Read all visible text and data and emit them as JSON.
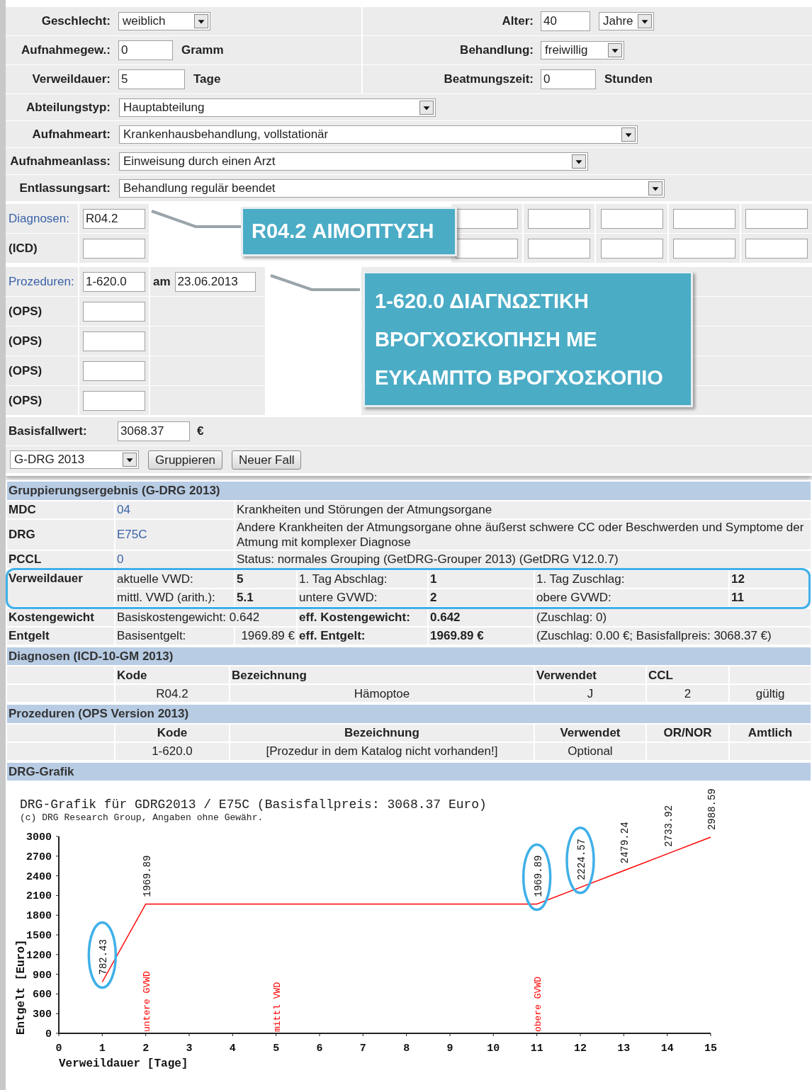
{
  "case_form": {
    "rows": [
      {
        "left": {
          "label": "Geschlecht:",
          "controls": [
            {
              "kind": "select",
              "value": "weiblich"
            }
          ]
        },
        "right": {
          "label": "Alter:",
          "controls": [
            {
              "kind": "input",
              "value": "40"
            },
            {
              "kind": "select",
              "value": "Jahre"
            }
          ]
        }
      },
      {
        "left": {
          "label": "Aufnahmegew.:",
          "controls": [
            {
              "kind": "input",
              "value": "0"
            }
          ],
          "unit": "Gramm"
        },
        "right": {
          "label": "Behandlung:",
          "controls": [
            {
              "kind": "select",
              "value": "freiwillig"
            }
          ]
        }
      },
      {
        "left": {
          "label": "Verweildauer:",
          "controls": [
            {
              "kind": "input",
              "value": "5"
            }
          ],
          "unit": "Tage"
        },
        "right": {
          "label": "Beatmungszeit:",
          "controls": [
            {
              "kind": "input",
              "value": "0"
            }
          ],
          "unit": "Stunden"
        }
      }
    ],
    "wide_rows": [
      {
        "label": "Abteilungstyp:",
        "value": "Hauptabteilung"
      },
      {
        "label": "Aufnahmeart:",
        "value": "Krankenhausbehandlung, vollstationär"
      },
      {
        "label": "Aufnahmeanlass:",
        "value": "Einweisung durch einen Arzt"
      },
      {
        "label": "Entlassungsart:",
        "value": "Behandlung regulär beendet"
      }
    ]
  },
  "diagnoses": {
    "label": "Diagnosen:",
    "sublabel": "(ICD)",
    "code": "R04.2",
    "callout": "R04.2 ΑΙΜΟΠΤΥΣΗ"
  },
  "procedures": {
    "label": "Prozeduren:",
    "code": "1-620.0",
    "date_label": "am",
    "date": "23.06.2013",
    "extra_labels": [
      "(OPS)",
      "(OPS)",
      "(OPS)",
      "(OPS)"
    ],
    "callout_lines": [
      "1-620.0 ΔΙΑΓΝΩΣΤΙΚΗ",
      "ΒΡΟΓΧΟΣΚΟΠΗΣΗ ΜΕ",
      "ΕΥΚΑΜΠΤΟ ΒΡΟΓΧΟΣΚΟΠΙΟ"
    ]
  },
  "base_rate": {
    "label": "Basisfallwert:",
    "value": "3068.37",
    "unit": "€"
  },
  "actions": {
    "catalog": "G-DRG 2013",
    "buttons": [
      "Gruppieren",
      "Neuer Fall"
    ]
  },
  "result": {
    "title": "Gruppierungsergebnis (G-DRG 2013)",
    "rows": [
      {
        "kind": "link",
        "label": "MDC",
        "link": "04",
        "text": "Krankheiten und Störungen der Atmungsorgane"
      },
      {
        "kind": "link",
        "label": "DRG",
        "link": "E75C",
        "text": "Andere Krankheiten der Atmungsorgane ohne äußerst schwere CC oder Beschwerden und Symptome der Atmung mit komplexer Diagnose"
      },
      {
        "kind": "link",
        "label": "PCCL",
        "link": "0",
        "text": "Status: normales Grouping (GetDRG-Grouper 2013) (GetDRG V12.0.7)"
      },
      {
        "kind": "stay",
        "label": "Verweildauer",
        "highlighted": true,
        "lines": [
          [
            "aktuelle VWD:",
            "5",
            "1. Tag Abschlag:",
            "1",
            "1. Tag Zuschlag:",
            "12"
          ],
          [
            "mittl. VWD (arith.):",
            "5.1",
            "untere GVWD:",
            "2",
            "obere GVWD:",
            "11"
          ]
        ]
      },
      {
        "kind": "weight",
        "label": "Kostengewicht",
        "cells": [
          "Basiskostengewicht: 0.642",
          "eff. Kostengewicht:",
          "0.642",
          "(Zuschlag: 0)"
        ]
      },
      {
        "kind": "fee",
        "label": "Entgelt",
        "cells": [
          "Basisentgelt:",
          "1969.89 €",
          "eff. Entgelt:",
          "1969.89 €",
          "(Zuschlag: 0.00 €; Basisfallpreis: 3068.37 €)"
        ]
      }
    ]
  },
  "diagnosis_table": {
    "title": "Diagnosen (ICD-10-GM 2013)",
    "columns": [
      "Kode",
      "Bezeichnung",
      "Verwendet",
      "CCL"
    ],
    "rows": [
      [
        "R04.2",
        "Hämoptoe",
        "J",
        "2",
        "gültig"
      ]
    ]
  },
  "procedure_table": {
    "title": "Prozeduren (OPS Version 2013)",
    "columns": [
      "Kode",
      "Bezeichnung",
      "Verwendet",
      "OR/NOR",
      "Amtlich"
    ],
    "rows": [
      [
        "1-620.0",
        "[Prozedur in dem Katalog nicht vorhanden!]",
        "Optional"
      ]
    ]
  },
  "graphic": {
    "title": "DRG-Grafik",
    "caption": "(c) DRG Research Group, Angaben ohne Gewähr.",
    "circled": [
      true,
      false,
      true,
      true,
      false,
      false,
      false
    ],
    "markers": [
      {
        "day": "2",
        "text": "untere GVWD"
      },
      {
        "day": "5",
        "text": "mittl VWD"
      },
      {
        "day": "11",
        "text": "obere GVWD"
      }
    ],
    "chart_data": {
      "type": "line",
      "title": "DRG-Grafik für GDRG2013 / E75C (Basisfallpreis: 3068.37 Euro)",
      "xlabel": "Verweildauer [Tage]",
      "ylabel": "Entgelt [Euro]",
      "x": [
        1,
        2,
        11,
        12,
        13,
        14,
        15
      ],
      "series": [
        {
          "color": "#ff0000",
          "values": [
            782.43,
            1969.89,
            1969.89,
            2224.57,
            2479.24,
            2733.92,
            2988.59
          ]
        }
      ],
      "xlim": [
        0,
        15
      ],
      "ylim": [
        0,
        3000
      ],
      "xticks": [
        0,
        1,
        2,
        3,
        4,
        5,
        6,
        7,
        8,
        9,
        10,
        11,
        12,
        13,
        14,
        15
      ],
      "yticks": [
        0,
        300,
        600,
        900,
        1200,
        1500,
        1800,
        2100,
        2400,
        2700,
        3000
      ],
      "data_labels": true
    }
  }
}
